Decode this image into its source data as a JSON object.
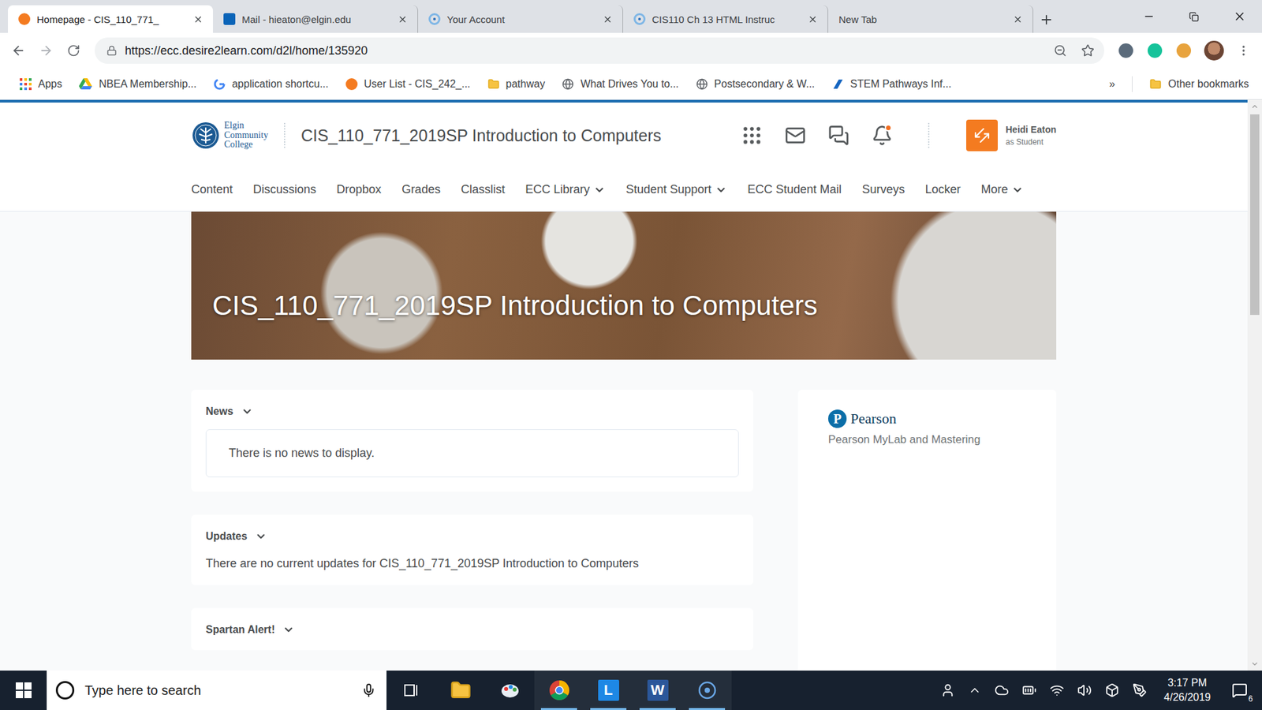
{
  "browser": {
    "tabs": [
      {
        "label": "Homepage - CIS_110_771_",
        "selected": true,
        "kind": "d2l"
      },
      {
        "label": "Mail - hieaton@elgin.edu",
        "selected": false,
        "kind": "outlook"
      },
      {
        "label": "Your Account",
        "selected": false,
        "kind": "circle"
      },
      {
        "label": "CIS110 Ch 13 HTML Instruc",
        "selected": false,
        "kind": "circle"
      },
      {
        "label": "New Tab",
        "selected": false,
        "kind": "none"
      }
    ],
    "url": "https://ecc.desire2learn.com/d2l/home/135920",
    "bookmarks": [
      {
        "label": "Apps",
        "kind": "apps"
      },
      {
        "label": "NBEA Membership...",
        "kind": "drive"
      },
      {
        "label": "application shortcu...",
        "kind": "google"
      },
      {
        "label": "User List - CIS_242_...",
        "kind": "d2l"
      },
      {
        "label": "pathway",
        "kind": "folder"
      },
      {
        "label": "What Drives You to...",
        "kind": "globe"
      },
      {
        "label": "Postsecondary & W...",
        "kind": "globe"
      },
      {
        "label": "STEM Pathways Inf...",
        "kind": "stem"
      }
    ],
    "bookmarks_overflow": "»",
    "other_bookmarks": "Other bookmarks"
  },
  "page": {
    "logo": {
      "lines": [
        "Elgin",
        "Community",
        "College"
      ]
    },
    "course_title": "CIS_110_771_2019SP Introduction to Computers",
    "alerts_unread": true,
    "user": {
      "name": "Heidi Eaton",
      "role": "as Student"
    },
    "nav": [
      {
        "label": "Content",
        "dropdown": false
      },
      {
        "label": "Discussions",
        "dropdown": false
      },
      {
        "label": "Dropbox",
        "dropdown": false
      },
      {
        "label": "Grades",
        "dropdown": false
      },
      {
        "label": "Classlist",
        "dropdown": false
      },
      {
        "label": "ECC Library",
        "dropdown": true
      },
      {
        "label": "Student Support",
        "dropdown": true
      },
      {
        "label": "ECC Student Mail",
        "dropdown": false
      },
      {
        "label": "Surveys",
        "dropdown": false
      },
      {
        "label": "Locker",
        "dropdown": false
      },
      {
        "label": "More",
        "dropdown": true
      }
    ],
    "banner_title": "CIS_110_771_2019SP Introduction to Computers",
    "widgets": [
      {
        "title": "News",
        "kind": "boxed",
        "message": "There is no news to display."
      },
      {
        "title": "Updates",
        "kind": "plain",
        "message": "There are no current updates for CIS_110_771_2019SP Introduction to Computers"
      },
      {
        "title": "Spartan Alert!",
        "kind": "cut",
        "message": ""
      }
    ],
    "side_widget": {
      "logo_letter": "P",
      "brand": "Pearson",
      "link": "Pearson MyLab and Mastering"
    },
    "scrollbar": {
      "level": 0.37
    }
  },
  "taskbar": {
    "search_placeholder": "Type here to search",
    "apps": [
      {
        "kind": "task-view",
        "label": "",
        "running": false
      },
      {
        "kind": "explorer",
        "label": "",
        "running": false
      },
      {
        "kind": "paint",
        "label": "",
        "running": false
      },
      {
        "kind": "chrome",
        "label": "",
        "running": true
      },
      {
        "kind": "tile",
        "label": "L",
        "running": true
      },
      {
        "kind": "word",
        "label": "W",
        "running": true
      },
      {
        "kind": "circle",
        "label": "",
        "running": true
      }
    ],
    "time": "3:17 PM",
    "date": "4/26/2019",
    "notifications": "6"
  }
}
